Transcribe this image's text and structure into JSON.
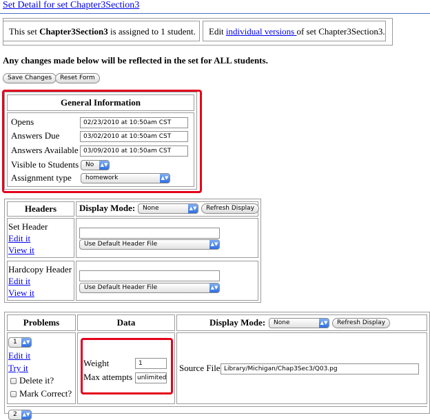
{
  "page": {
    "title": "Set Detail for set Chapter3Section3"
  },
  "info": {
    "assigned_prefix": "This set ",
    "set_name": "Chapter3Section3",
    "assigned_suffix": " is assigned to 1 student.",
    "edit_prefix": "Edit ",
    "edit_link": "individual versions ",
    "edit_suffix": "of set Chapter3Section3."
  },
  "warning": "Any changes made below will be reflected in the set for ALL students.",
  "buttons": {
    "save": "Save Changes",
    "reset": "Reset Form"
  },
  "general_info": {
    "heading": "General Information",
    "opens_label": "Opens",
    "opens_value": "02/23/2010 at 10:50am CST",
    "due_label": "Answers Due",
    "due_value": "03/02/2010 at 10:50am CST",
    "available_label": "Answers Available",
    "available_value": "03/09/2010 at 10:50am CST",
    "visible_label": "Visible to Students",
    "visible_value": "No",
    "type_label": "Assignment type",
    "type_value": "homework"
  },
  "headers": {
    "heading": "Headers",
    "display_mode_label": "Display Mode:",
    "display_mode_value": "None",
    "refresh": "Refresh Display",
    "set_header_label": "Set Header",
    "hardcopy_header_label": "Hardcopy Header",
    "edit_it": "Edit it",
    "view_it": "View it",
    "header_file_default": "Use Default Header File"
  },
  "problems": {
    "heading": "Problems",
    "data_heading": "Data",
    "display_mode_label": "Display Mode:",
    "display_mode_value": "None",
    "refresh": "Refresh Display",
    "problem_number": "1",
    "edit_it": "Edit it",
    "try_it": "Try it",
    "delete_label": "Delete it?",
    "mark_correct_label": "Mark Correct?",
    "weight_label": "Weight",
    "weight_value": "1",
    "max_attempts_label": "Max attempts",
    "max_attempts_value": "unlimited",
    "source_file_label": "Source File",
    "source_file_value": "Library/Michigan/Chap3Sec3/Q03.pg",
    "next_problem_number": "2"
  },
  "colors": {
    "link": "#0000ee",
    "highlight": "#e3001b",
    "rule": "#4a6fc9"
  }
}
